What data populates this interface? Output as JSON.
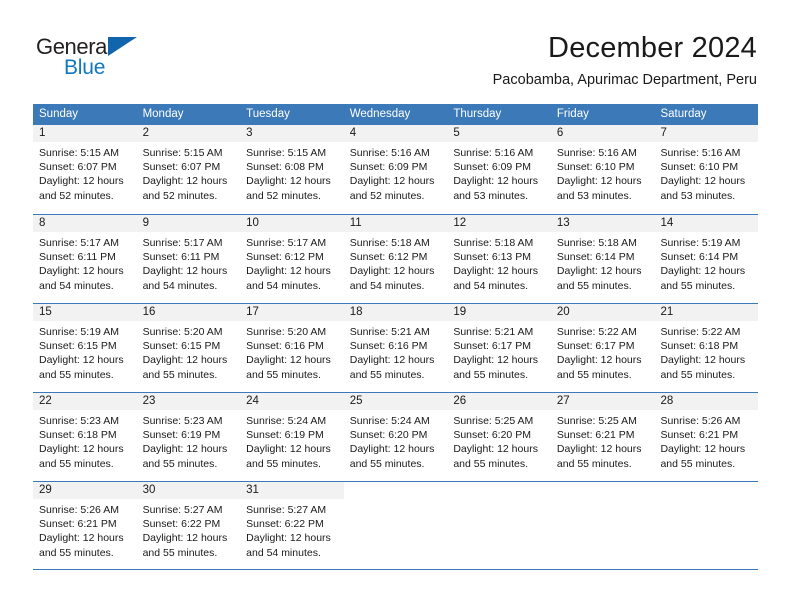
{
  "brand": {
    "name_top": "General",
    "name_bottom": "Blue",
    "accent_color": "#1278be",
    "triangle_color": "#1065ad"
  },
  "header": {
    "title": "December 2024",
    "subtitle": "Pacobamba, Apurimac Department, Peru"
  },
  "calendar": {
    "header_bg_color": "#3b79b8",
    "day_number_bg_color": "#f2f2f2",
    "weekdays": [
      "Sunday",
      "Monday",
      "Tuesday",
      "Wednesday",
      "Thursday",
      "Friday",
      "Saturday"
    ],
    "weeks": [
      [
        {
          "day": "1",
          "sunrise": "Sunrise: 5:15 AM",
          "sunset": "Sunset: 6:07 PM",
          "daylight": "Daylight: 12 hours and 52 minutes."
        },
        {
          "day": "2",
          "sunrise": "Sunrise: 5:15 AM",
          "sunset": "Sunset: 6:07 PM",
          "daylight": "Daylight: 12 hours and 52 minutes."
        },
        {
          "day": "3",
          "sunrise": "Sunrise: 5:15 AM",
          "sunset": "Sunset: 6:08 PM",
          "daylight": "Daylight: 12 hours and 52 minutes."
        },
        {
          "day": "4",
          "sunrise": "Sunrise: 5:16 AM",
          "sunset": "Sunset: 6:09 PM",
          "daylight": "Daylight: 12 hours and 52 minutes."
        },
        {
          "day": "5",
          "sunrise": "Sunrise: 5:16 AM",
          "sunset": "Sunset: 6:09 PM",
          "daylight": "Daylight: 12 hours and 53 minutes."
        },
        {
          "day": "6",
          "sunrise": "Sunrise: 5:16 AM",
          "sunset": "Sunset: 6:10 PM",
          "daylight": "Daylight: 12 hours and 53 minutes."
        },
        {
          "day": "7",
          "sunrise": "Sunrise: 5:16 AM",
          "sunset": "Sunset: 6:10 PM",
          "daylight": "Daylight: 12 hours and 53 minutes."
        }
      ],
      [
        {
          "day": "8",
          "sunrise": "Sunrise: 5:17 AM",
          "sunset": "Sunset: 6:11 PM",
          "daylight": "Daylight: 12 hours and 54 minutes."
        },
        {
          "day": "9",
          "sunrise": "Sunrise: 5:17 AM",
          "sunset": "Sunset: 6:11 PM",
          "daylight": "Daylight: 12 hours and 54 minutes."
        },
        {
          "day": "10",
          "sunrise": "Sunrise: 5:17 AM",
          "sunset": "Sunset: 6:12 PM",
          "daylight": "Daylight: 12 hours and 54 minutes."
        },
        {
          "day": "11",
          "sunrise": "Sunrise: 5:18 AM",
          "sunset": "Sunset: 6:12 PM",
          "daylight": "Daylight: 12 hours and 54 minutes."
        },
        {
          "day": "12",
          "sunrise": "Sunrise: 5:18 AM",
          "sunset": "Sunset: 6:13 PM",
          "daylight": "Daylight: 12 hours and 54 minutes."
        },
        {
          "day": "13",
          "sunrise": "Sunrise: 5:18 AM",
          "sunset": "Sunset: 6:14 PM",
          "daylight": "Daylight: 12 hours and 55 minutes."
        },
        {
          "day": "14",
          "sunrise": "Sunrise: 5:19 AM",
          "sunset": "Sunset: 6:14 PM",
          "daylight": "Daylight: 12 hours and 55 minutes."
        }
      ],
      [
        {
          "day": "15",
          "sunrise": "Sunrise: 5:19 AM",
          "sunset": "Sunset: 6:15 PM",
          "daylight": "Daylight: 12 hours and 55 minutes."
        },
        {
          "day": "16",
          "sunrise": "Sunrise: 5:20 AM",
          "sunset": "Sunset: 6:15 PM",
          "daylight": "Daylight: 12 hours and 55 minutes."
        },
        {
          "day": "17",
          "sunrise": "Sunrise: 5:20 AM",
          "sunset": "Sunset: 6:16 PM",
          "daylight": "Daylight: 12 hours and 55 minutes."
        },
        {
          "day": "18",
          "sunrise": "Sunrise: 5:21 AM",
          "sunset": "Sunset: 6:16 PM",
          "daylight": "Daylight: 12 hours and 55 minutes."
        },
        {
          "day": "19",
          "sunrise": "Sunrise: 5:21 AM",
          "sunset": "Sunset: 6:17 PM",
          "daylight": "Daylight: 12 hours and 55 minutes."
        },
        {
          "day": "20",
          "sunrise": "Sunrise: 5:22 AM",
          "sunset": "Sunset: 6:17 PM",
          "daylight": "Daylight: 12 hours and 55 minutes."
        },
        {
          "day": "21",
          "sunrise": "Sunrise: 5:22 AM",
          "sunset": "Sunset: 6:18 PM",
          "daylight": "Daylight: 12 hours and 55 minutes."
        }
      ],
      [
        {
          "day": "22",
          "sunrise": "Sunrise: 5:23 AM",
          "sunset": "Sunset: 6:18 PM",
          "daylight": "Daylight: 12 hours and 55 minutes."
        },
        {
          "day": "23",
          "sunrise": "Sunrise: 5:23 AM",
          "sunset": "Sunset: 6:19 PM",
          "daylight": "Daylight: 12 hours and 55 minutes."
        },
        {
          "day": "24",
          "sunrise": "Sunrise: 5:24 AM",
          "sunset": "Sunset: 6:19 PM",
          "daylight": "Daylight: 12 hours and 55 minutes."
        },
        {
          "day": "25",
          "sunrise": "Sunrise: 5:24 AM",
          "sunset": "Sunset: 6:20 PM",
          "daylight": "Daylight: 12 hours and 55 minutes."
        },
        {
          "day": "26",
          "sunrise": "Sunrise: 5:25 AM",
          "sunset": "Sunset: 6:20 PM",
          "daylight": "Daylight: 12 hours and 55 minutes."
        },
        {
          "day": "27",
          "sunrise": "Sunrise: 5:25 AM",
          "sunset": "Sunset: 6:21 PM",
          "daylight": "Daylight: 12 hours and 55 minutes."
        },
        {
          "day": "28",
          "sunrise": "Sunrise: 5:26 AM",
          "sunset": "Sunset: 6:21 PM",
          "daylight": "Daylight: 12 hours and 55 minutes."
        }
      ],
      [
        {
          "day": "29",
          "sunrise": "Sunrise: 5:26 AM",
          "sunset": "Sunset: 6:21 PM",
          "daylight": "Daylight: 12 hours and 55 minutes."
        },
        {
          "day": "30",
          "sunrise": "Sunrise: 5:27 AM",
          "sunset": "Sunset: 6:22 PM",
          "daylight": "Daylight: 12 hours and 55 minutes."
        },
        {
          "day": "31",
          "sunrise": "Sunrise: 5:27 AM",
          "sunset": "Sunset: 6:22 PM",
          "daylight": "Daylight: 12 hours and 54 minutes."
        },
        {
          "day": "",
          "sunrise": "",
          "sunset": "",
          "daylight": ""
        },
        {
          "day": "",
          "sunrise": "",
          "sunset": "",
          "daylight": ""
        },
        {
          "day": "",
          "sunrise": "",
          "sunset": "",
          "daylight": ""
        },
        {
          "day": "",
          "sunrise": "",
          "sunset": "",
          "daylight": ""
        }
      ]
    ]
  }
}
